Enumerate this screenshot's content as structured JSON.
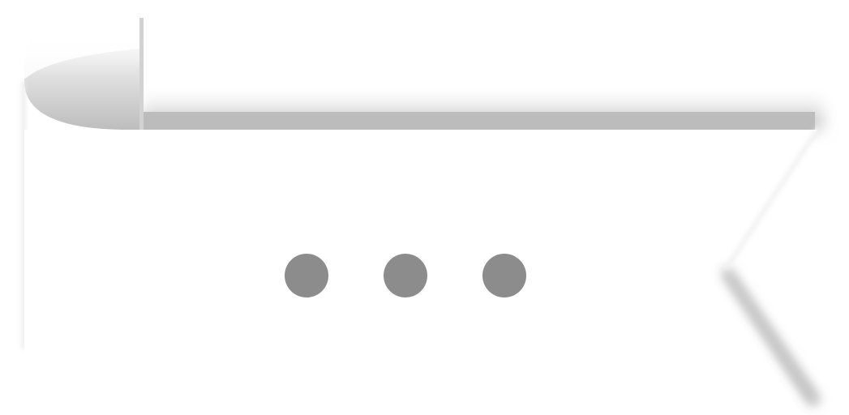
{
  "banner": {
    "icon": "more-horizontal-icon",
    "dot_count": 3,
    "colors": {
      "background": "#ffffff",
      "dot": "#8c8c8c",
      "shadow": "#a8a8a8"
    }
  }
}
